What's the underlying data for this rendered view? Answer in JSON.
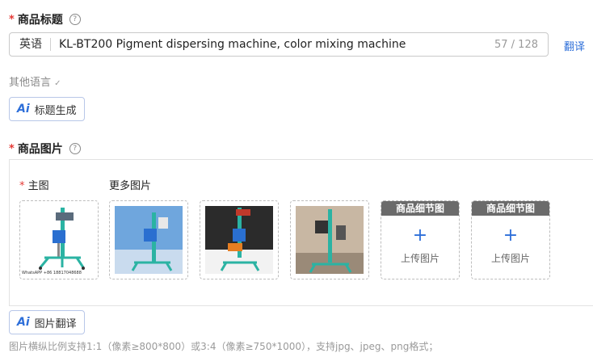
{
  "title_section": {
    "required_mark": "*",
    "label": "商品标题",
    "help_icon": "?"
  },
  "title_input": {
    "language": "英语",
    "value": "KL-BT200 Pigment dispersing machine, color mixing machine",
    "char_count": "57 / 128"
  },
  "translate_label": "翻译",
  "other_language": {
    "label": "其他语言",
    "chevron": "✓"
  },
  "ai_title_button": {
    "icon_text": "Ai",
    "label": "标题生成"
  },
  "image_section": {
    "required_mark": "*",
    "label": "商品图片",
    "help_icon": "?"
  },
  "images": {
    "main_required_mark": "*",
    "main_label": "主图",
    "more_label": "更多图片",
    "main_image_caption": "WhatsAPP +86 18817048688",
    "detail_slots": [
      {
        "header": "商品细节图",
        "plus": "+",
        "upload_label": "上传图片"
      },
      {
        "header": "商品细节图",
        "plus": "+",
        "upload_label": "上传图片"
      }
    ]
  },
  "ai_image_button": {
    "icon_text": "Ai",
    "label": "图片翻译"
  },
  "footer_note": "图片横纵比例支持1:1（像素≥800*800）或3:4（像素≥750*1000），支持jpg、jpeg、png格式；"
}
